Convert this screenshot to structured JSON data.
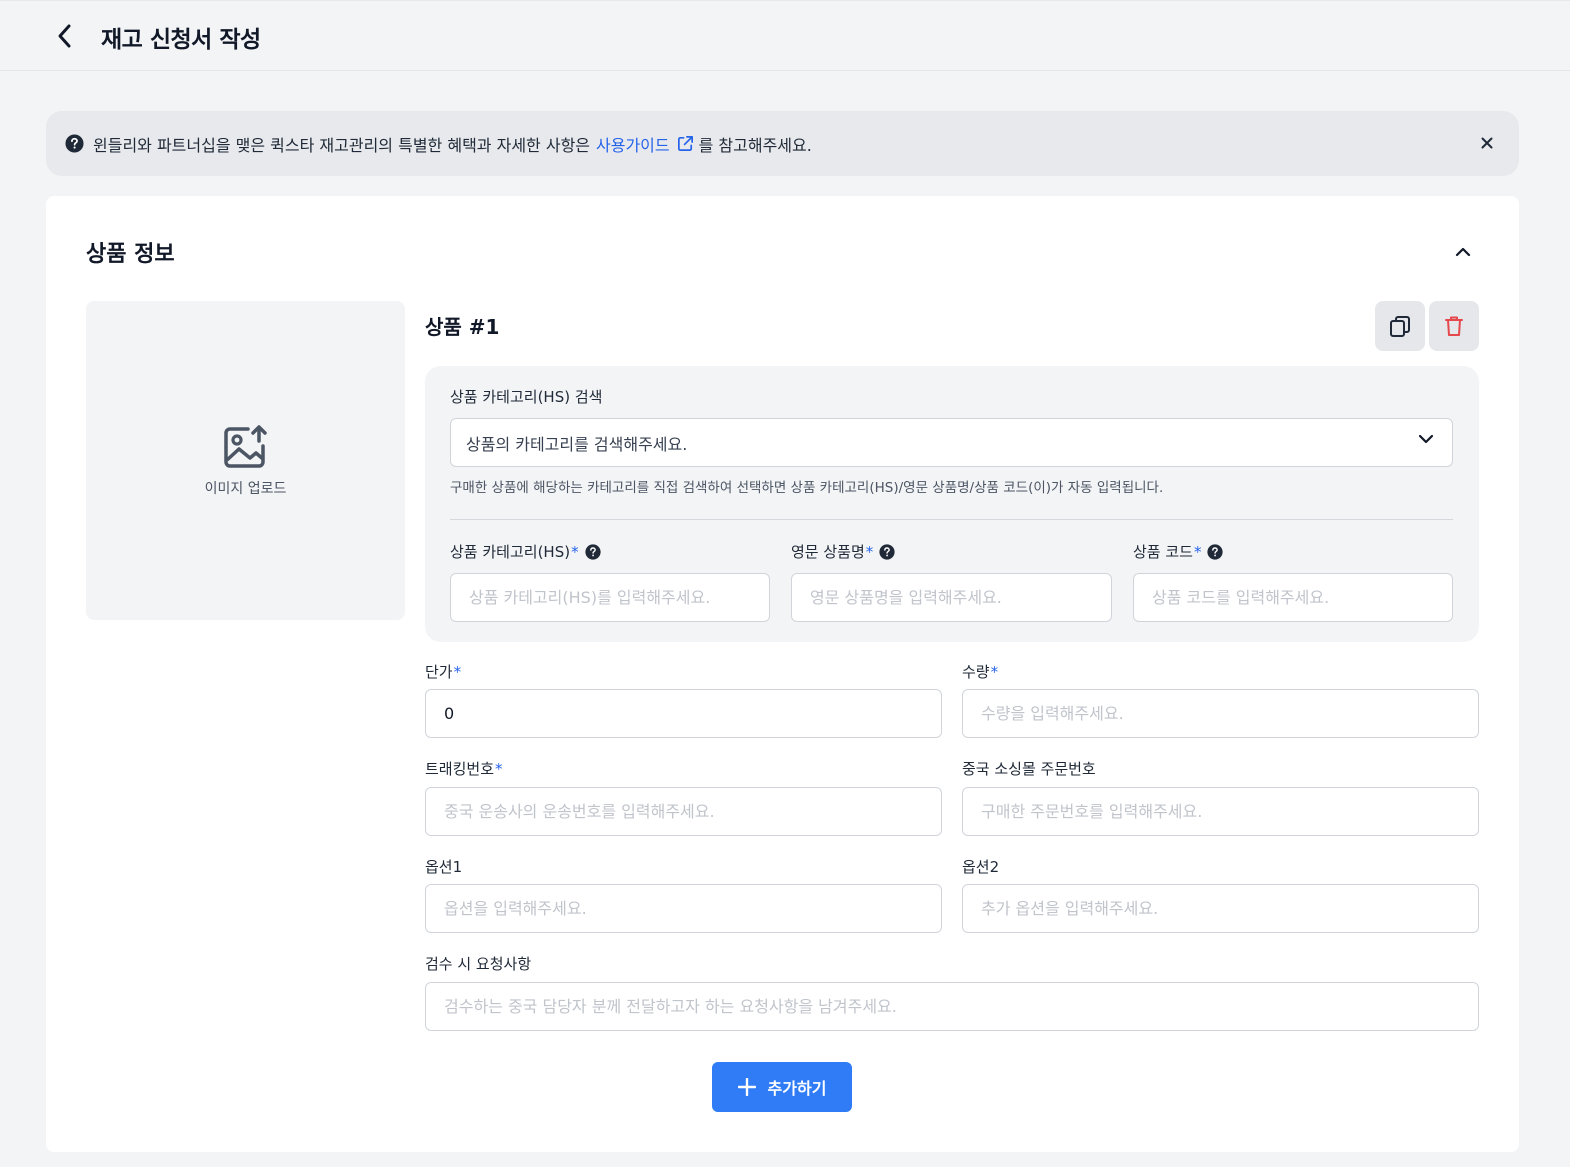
{
  "header": {
    "title": "재고 신청서 작성"
  },
  "notice": {
    "text_before": "윈들리와 파트너십을 맺은 퀵스타 재고관리의 특별한 혜택과 자세한 사항은",
    "link_label": "사용가이드",
    "text_after": "를 참고해주세요."
  },
  "section": {
    "title": "상품 정보"
  },
  "image_upload": {
    "label": "이미지 업로드"
  },
  "product": {
    "title": "상품 #1"
  },
  "hs_search": {
    "label": "상품 카테고리(HS) 검색",
    "placeholder": "상품의 카테고리를 검색해주세요.",
    "hint": "구매한 상품에 해당하는 카테고리를 직접 검색하여 선택하면 상품 카테고리(HS)/영문 상품명/상품 코드(이)가 자동 입력됩니다."
  },
  "fields": {
    "hs_category": {
      "label": "상품 카테고리(HS)",
      "required": "*",
      "placeholder": "상품 카테고리(HS)를 입력해주세요."
    },
    "english_name": {
      "label": "영문 상품명",
      "required": "*",
      "placeholder": "영문 상품명을 입력해주세요."
    },
    "product_code": {
      "label": "상품 코드",
      "required": "*",
      "placeholder": "상품 코드를 입력해주세요."
    },
    "unit_price": {
      "label": "단가",
      "required": "*",
      "value": "0"
    },
    "quantity": {
      "label": "수량",
      "required": "*",
      "placeholder": "수량을 입력해주세요."
    },
    "tracking": {
      "label": "트래킹번호",
      "required": "*",
      "placeholder": "중국 운송사의 운송번호를 입력해주세요."
    },
    "order_no": {
      "label": "중국 소싱몰 주문번호",
      "placeholder": "구매한 주문번호를 입력해주세요."
    },
    "option1": {
      "label": "옵션1",
      "placeholder": "옵션을 입력해주세요."
    },
    "option2": {
      "label": "옵션2",
      "placeholder": "추가 옵션을 입력해주세요."
    },
    "request": {
      "label": "검수 시 요청사항",
      "placeholder": "검수하는 중국 담당자 분께 전달하고자 하는 요청사항을 남겨주세요."
    }
  },
  "add_button": {
    "label": "추가하기"
  },
  "colors": {
    "accent": "#2f7cf6",
    "link": "#2563eb",
    "danger": "#e5484d"
  }
}
